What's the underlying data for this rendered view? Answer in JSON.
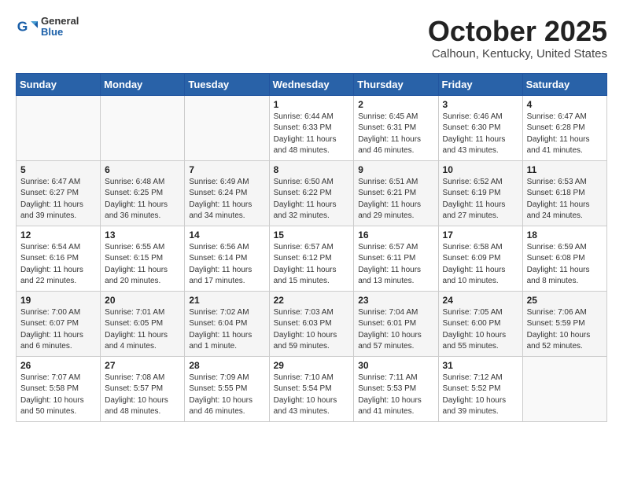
{
  "header": {
    "logo": {
      "general": "General",
      "blue": "Blue"
    },
    "title": "October 2025",
    "subtitle": "Calhoun, Kentucky, United States"
  },
  "weekdays": [
    "Sunday",
    "Monday",
    "Tuesday",
    "Wednesday",
    "Thursday",
    "Friday",
    "Saturday"
  ],
  "weeks": [
    [
      {
        "day": "",
        "info": ""
      },
      {
        "day": "",
        "info": ""
      },
      {
        "day": "",
        "info": ""
      },
      {
        "day": "1",
        "info": "Sunrise: 6:44 AM\nSunset: 6:33 PM\nDaylight: 11 hours\nand 48 minutes."
      },
      {
        "day": "2",
        "info": "Sunrise: 6:45 AM\nSunset: 6:31 PM\nDaylight: 11 hours\nand 46 minutes."
      },
      {
        "day": "3",
        "info": "Sunrise: 6:46 AM\nSunset: 6:30 PM\nDaylight: 11 hours\nand 43 minutes."
      },
      {
        "day": "4",
        "info": "Sunrise: 6:47 AM\nSunset: 6:28 PM\nDaylight: 11 hours\nand 41 minutes."
      }
    ],
    [
      {
        "day": "5",
        "info": "Sunrise: 6:47 AM\nSunset: 6:27 PM\nDaylight: 11 hours\nand 39 minutes."
      },
      {
        "day": "6",
        "info": "Sunrise: 6:48 AM\nSunset: 6:25 PM\nDaylight: 11 hours\nand 36 minutes."
      },
      {
        "day": "7",
        "info": "Sunrise: 6:49 AM\nSunset: 6:24 PM\nDaylight: 11 hours\nand 34 minutes."
      },
      {
        "day": "8",
        "info": "Sunrise: 6:50 AM\nSunset: 6:22 PM\nDaylight: 11 hours\nand 32 minutes."
      },
      {
        "day": "9",
        "info": "Sunrise: 6:51 AM\nSunset: 6:21 PM\nDaylight: 11 hours\nand 29 minutes."
      },
      {
        "day": "10",
        "info": "Sunrise: 6:52 AM\nSunset: 6:19 PM\nDaylight: 11 hours\nand 27 minutes."
      },
      {
        "day": "11",
        "info": "Sunrise: 6:53 AM\nSunset: 6:18 PM\nDaylight: 11 hours\nand 24 minutes."
      }
    ],
    [
      {
        "day": "12",
        "info": "Sunrise: 6:54 AM\nSunset: 6:16 PM\nDaylight: 11 hours\nand 22 minutes."
      },
      {
        "day": "13",
        "info": "Sunrise: 6:55 AM\nSunset: 6:15 PM\nDaylight: 11 hours\nand 20 minutes."
      },
      {
        "day": "14",
        "info": "Sunrise: 6:56 AM\nSunset: 6:14 PM\nDaylight: 11 hours\nand 17 minutes."
      },
      {
        "day": "15",
        "info": "Sunrise: 6:57 AM\nSunset: 6:12 PM\nDaylight: 11 hours\nand 15 minutes."
      },
      {
        "day": "16",
        "info": "Sunrise: 6:57 AM\nSunset: 6:11 PM\nDaylight: 11 hours\nand 13 minutes."
      },
      {
        "day": "17",
        "info": "Sunrise: 6:58 AM\nSunset: 6:09 PM\nDaylight: 11 hours\nand 10 minutes."
      },
      {
        "day": "18",
        "info": "Sunrise: 6:59 AM\nSunset: 6:08 PM\nDaylight: 11 hours\nand 8 minutes."
      }
    ],
    [
      {
        "day": "19",
        "info": "Sunrise: 7:00 AM\nSunset: 6:07 PM\nDaylight: 11 hours\nand 6 minutes."
      },
      {
        "day": "20",
        "info": "Sunrise: 7:01 AM\nSunset: 6:05 PM\nDaylight: 11 hours\nand 4 minutes."
      },
      {
        "day": "21",
        "info": "Sunrise: 7:02 AM\nSunset: 6:04 PM\nDaylight: 11 hours\nand 1 minute."
      },
      {
        "day": "22",
        "info": "Sunrise: 7:03 AM\nSunset: 6:03 PM\nDaylight: 10 hours\nand 59 minutes."
      },
      {
        "day": "23",
        "info": "Sunrise: 7:04 AM\nSunset: 6:01 PM\nDaylight: 10 hours\nand 57 minutes."
      },
      {
        "day": "24",
        "info": "Sunrise: 7:05 AM\nSunset: 6:00 PM\nDaylight: 10 hours\nand 55 minutes."
      },
      {
        "day": "25",
        "info": "Sunrise: 7:06 AM\nSunset: 5:59 PM\nDaylight: 10 hours\nand 52 minutes."
      }
    ],
    [
      {
        "day": "26",
        "info": "Sunrise: 7:07 AM\nSunset: 5:58 PM\nDaylight: 10 hours\nand 50 minutes."
      },
      {
        "day": "27",
        "info": "Sunrise: 7:08 AM\nSunset: 5:57 PM\nDaylight: 10 hours\nand 48 minutes."
      },
      {
        "day": "28",
        "info": "Sunrise: 7:09 AM\nSunset: 5:55 PM\nDaylight: 10 hours\nand 46 minutes."
      },
      {
        "day": "29",
        "info": "Sunrise: 7:10 AM\nSunset: 5:54 PM\nDaylight: 10 hours\nand 43 minutes."
      },
      {
        "day": "30",
        "info": "Sunrise: 7:11 AM\nSunset: 5:53 PM\nDaylight: 10 hours\nand 41 minutes."
      },
      {
        "day": "31",
        "info": "Sunrise: 7:12 AM\nSunset: 5:52 PM\nDaylight: 10 hours\nand 39 minutes."
      },
      {
        "day": "",
        "info": ""
      }
    ]
  ]
}
